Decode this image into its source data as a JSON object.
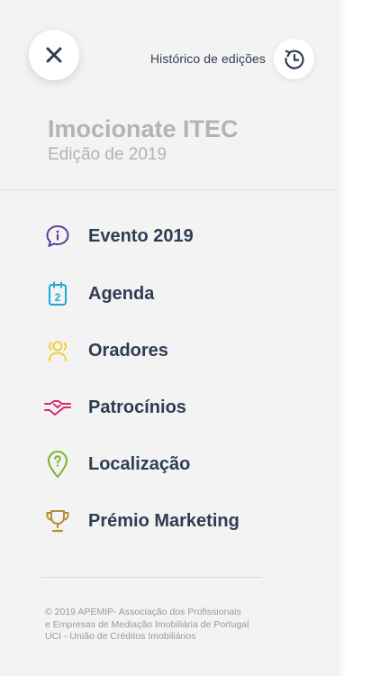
{
  "header": {
    "history_label": "Histórico de edições"
  },
  "event": {
    "title": "Imocionate ITEC",
    "edition": "Edição de 2019"
  },
  "menu": {
    "items": [
      {
        "label": "Evento 2019",
        "icon": "info-bubble-icon",
        "color": "#5b3c9e"
      },
      {
        "label": "Agenda",
        "icon": "calendar-icon",
        "color": "#1fa9d6"
      },
      {
        "label": "Oradores",
        "icon": "speakers-icon",
        "color": "#f2cf3a"
      },
      {
        "label": "Patrocínios",
        "icon": "handshake-icon",
        "color": "#d6287a"
      },
      {
        "label": "Localização",
        "icon": "location-pin-icon",
        "color": "#7bb52f"
      },
      {
        "label": "Prémio Marketing",
        "icon": "trophy-icon",
        "color": "#b98a38"
      }
    ]
  },
  "calendar_icon_number": "2",
  "footer": {
    "lines": [
      "© 2019 APEMIP- Associação dos Profissionais",
      "e Empresas de Mediação Imobiliária de Portugal",
      "UCI - União de Créditos Imobiliários"
    ]
  },
  "colors": {
    "drawer_background": "#f3f3f3",
    "text_dark": "#2f3d52",
    "title_gray": "#b3b3b3"
  }
}
